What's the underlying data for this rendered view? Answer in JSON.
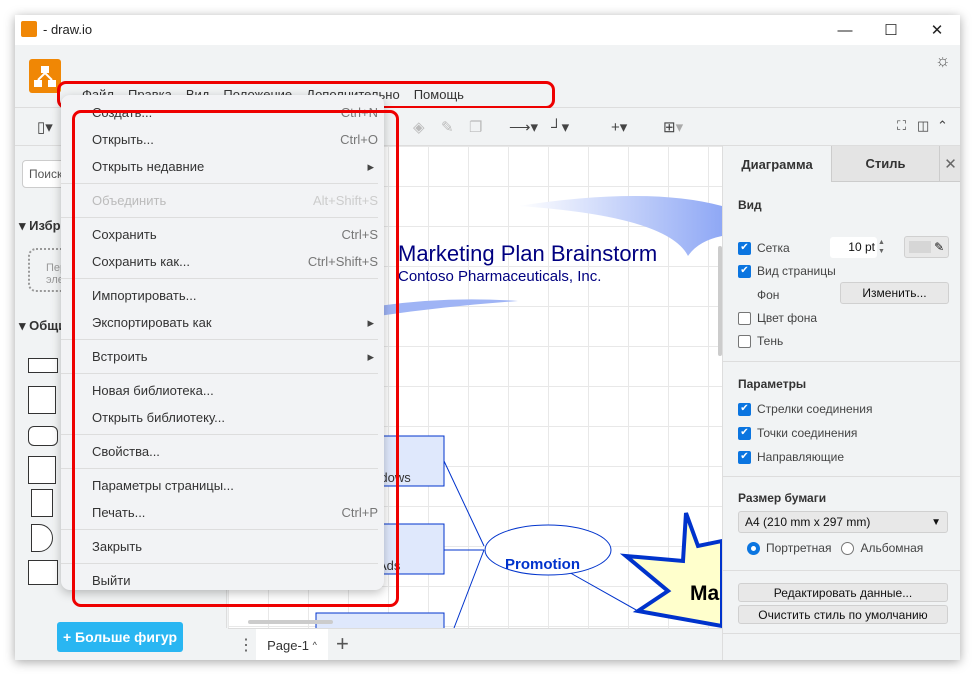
{
  "window": {
    "title": "- draw.io",
    "minimize": "—",
    "maximize": "☐",
    "close": "✕"
  },
  "menubar": [
    "Файл",
    "Правка",
    "Вид",
    "Положение",
    "Дополнительно",
    "Помощь"
  ],
  "sidebar": {
    "search_placeholder": "Поиск фигур",
    "favorites": "Избранное",
    "drop_hint": "Перетащите сюда элементы",
    "general": "Общие",
    "more_shapes": "+ Больше фигур"
  },
  "file_menu": [
    {
      "label": "Создать...",
      "shortcut": "Ctrl+N"
    },
    {
      "label": "Открыть...",
      "shortcut": "Ctrl+O"
    },
    {
      "label": "Открыть недавние",
      "submenu": true
    },
    {
      "sep": true
    },
    {
      "label": "Объединить",
      "shortcut": "Alt+Shift+S",
      "disabled": true
    },
    {
      "sep": true
    },
    {
      "label": "Сохранить",
      "shortcut": "Ctrl+S"
    },
    {
      "label": "Сохранить как...",
      "shortcut": "Ctrl+Shift+S"
    },
    {
      "sep": true
    },
    {
      "label": "Импортировать..."
    },
    {
      "label": "Экспортировать как",
      "submenu": true
    },
    {
      "sep": true
    },
    {
      "label": "Встроить",
      "submenu": true
    },
    {
      "sep": true
    },
    {
      "label": "Новая библиотека..."
    },
    {
      "label": "Открыть библиотеку..."
    },
    {
      "sep": true
    },
    {
      "label": "Свойства..."
    },
    {
      "sep": true
    },
    {
      "label": "Параметры страницы..."
    },
    {
      "label": "Печать...",
      "shortcut": "Ctrl+P"
    },
    {
      "sep": true
    },
    {
      "label": "Закрыть"
    },
    {
      "sep": true
    },
    {
      "label": "Выйти"
    }
  ],
  "canvas": {
    "title": "Marketing Plan Brainstorm",
    "subtitle": "Contoso Pharmaceuticals, Inc.",
    "box1": "Windows",
    "box2": "Ads",
    "ellipse": "Promotion",
    "star": "Ma"
  },
  "footer": {
    "page": "Page-1",
    "add": "+"
  },
  "panel": {
    "tabs": [
      "Диаграмма",
      "Стиль"
    ],
    "view": "Вид",
    "grid": "Сетка",
    "grid_size": "10 pt",
    "page_view": "Вид страницы",
    "background": "Фон",
    "change": "Изменить...",
    "bg_color": "Цвет фона",
    "shadow": "Тень",
    "options": "Параметры",
    "connection_arrows": "Стрелки соединения",
    "connection_points": "Точки соединения",
    "guides": "Направляющие",
    "paper_size": "Размер бумаги",
    "paper_value": "A4 (210 mm x 297 mm)",
    "portrait": "Портретная",
    "landscape": "Альбомная",
    "edit_data": "Редактировать данные...",
    "clear_style": "Очистить стиль по умолчанию",
    "checks": {
      "grid": true,
      "page_view": true,
      "bg_color": false,
      "shadow": false,
      "arrows": true,
      "points": true,
      "guides": true
    },
    "orientation": "portrait"
  },
  "colors": {
    "accent": "#f08705",
    "highlight": "#e00000",
    "button": "#29b6f2",
    "checkbox": "#0b75e0",
    "diagram_text": "#000080"
  }
}
